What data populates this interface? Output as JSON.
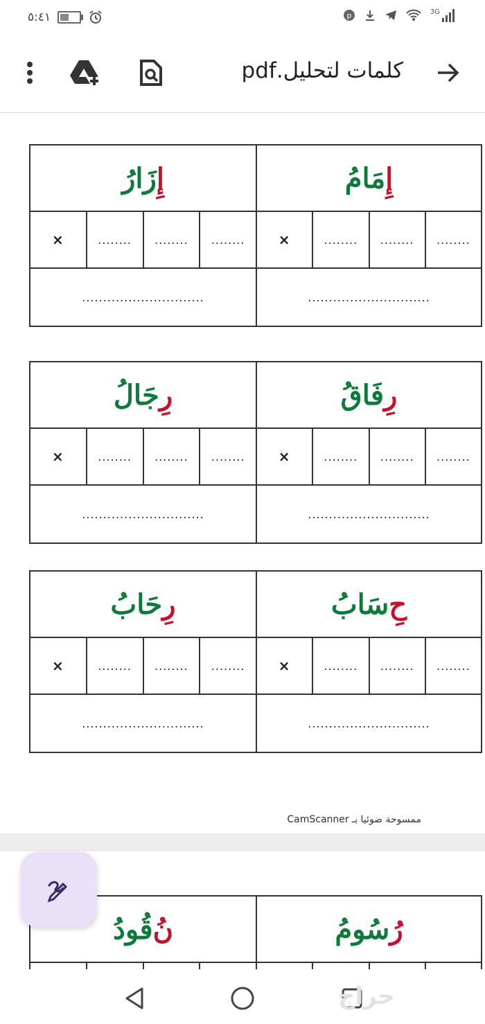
{
  "status_bar": {
    "time": "٥:٤١",
    "battery_level": 0.45,
    "network": "3G"
  },
  "app_bar": {
    "title": "كلمات لتحليل.pdf"
  },
  "cards": [
    {
      "right_word": {
        "parts": [
          {
            "t": "إِ",
            "c": "red"
          },
          {
            "t": "مَامُ",
            "c": "green"
          }
        ]
      },
      "left_word": {
        "parts": [
          {
            "t": "إِ",
            "c": "red"
          },
          {
            "t": "زَارُ",
            "c": "green"
          }
        ]
      },
      "letter_blank": "........",
      "mark": "×",
      "line_blank": "............................."
    },
    {
      "right_word": {
        "parts": [
          {
            "t": "رِ",
            "c": "red"
          },
          {
            "t": "فَاقُ",
            "c": "green"
          }
        ]
      },
      "left_word": {
        "parts": [
          {
            "t": "رِ",
            "c": "red"
          },
          {
            "t": "جَالُ",
            "c": "green"
          }
        ]
      },
      "letter_blank": "........",
      "mark": "×",
      "line_blank": "............................."
    },
    {
      "right_word": {
        "parts": [
          {
            "t": "حِ",
            "c": "red"
          },
          {
            "t": "سَابُ",
            "c": "green"
          }
        ]
      },
      "left_word": {
        "parts": [
          {
            "t": "رِ",
            "c": "red"
          },
          {
            "t": "حَابُ",
            "c": "green"
          }
        ]
      },
      "letter_blank": "........",
      "mark": "×",
      "line_blank": "............................."
    }
  ],
  "footer_note": "ممسوحة ضوئيا بـ CamScanner",
  "page2_card": {
    "right_word": {
      "parts": [
        {
          "t": "رُ",
          "c": "red"
        },
        {
          "t": "سُومُ",
          "c": "green"
        }
      ]
    },
    "left_word": {
      "parts": [
        {
          "t": "نُ",
          "c": "red"
        },
        {
          "t": "قُودُ",
          "c": "green"
        }
      ]
    }
  },
  "watermark": "حراج",
  "colors": {
    "green": "#0e7a3a",
    "red": "#c8102e",
    "fab_bg": "#e9e1f7"
  }
}
